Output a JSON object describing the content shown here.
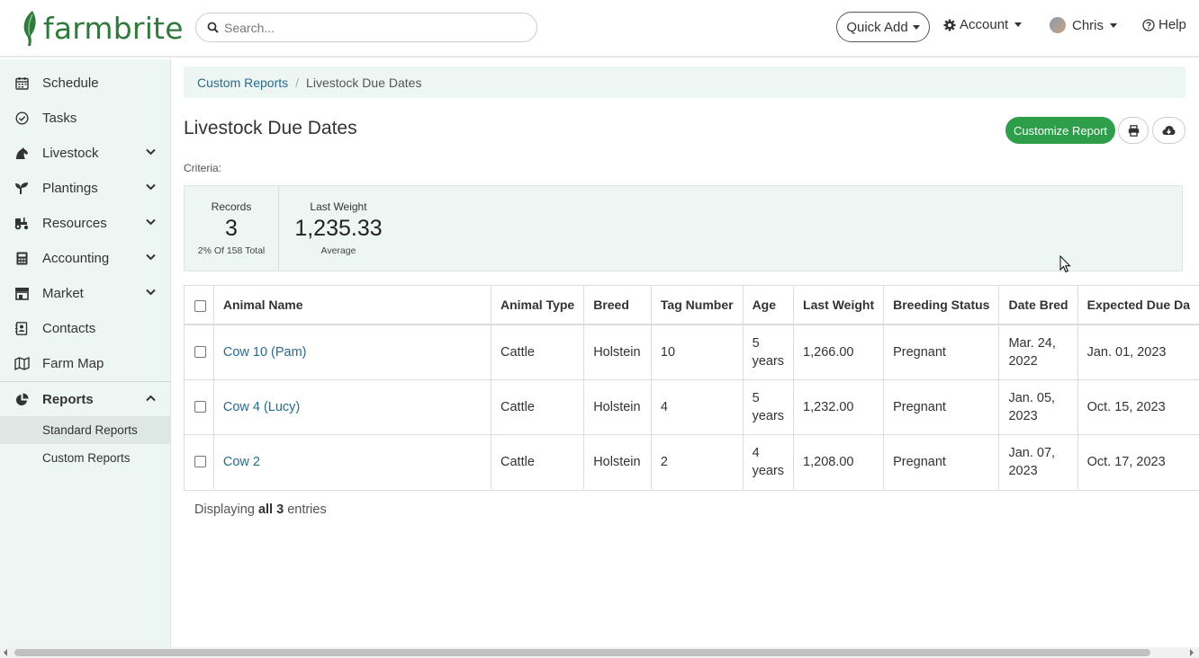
{
  "brand": {
    "name": "farmbrite",
    "color": "#2f7a3c"
  },
  "search": {
    "placeholder": "Search..."
  },
  "topnav": {
    "quick_add": "Quick Add",
    "account": "Account",
    "user": "Chris",
    "help": "Help"
  },
  "sidebar": {
    "items": [
      {
        "label": "Schedule",
        "icon": "calendar-icon"
      },
      {
        "label": "Tasks",
        "icon": "check-circle-icon"
      },
      {
        "label": "Livestock",
        "icon": "horse-icon"
      },
      {
        "label": "Plantings",
        "icon": "seedling-icon"
      },
      {
        "label": "Resources",
        "icon": "tractor-icon"
      },
      {
        "label": "Accounting",
        "icon": "calculator-icon"
      },
      {
        "label": "Market",
        "icon": "store-icon"
      },
      {
        "label": "Contacts",
        "icon": "address-book-icon"
      },
      {
        "label": "Farm Map",
        "icon": "map-icon"
      },
      {
        "label": "Reports",
        "icon": "pie-chart-icon"
      }
    ],
    "reports_sub": [
      "Standard Reports",
      "Custom Reports"
    ]
  },
  "breadcrumb": {
    "parent": "Custom Reports",
    "current": "Livestock Due Dates"
  },
  "page": {
    "title": "Livestock Due Dates",
    "customize": "Customize Report",
    "criteria": "Criteria:"
  },
  "stats": {
    "records": {
      "label": "Records",
      "value": "3",
      "sub": "2% Of 158 Total"
    },
    "weight": {
      "label": "Last Weight",
      "value": "1,235.33",
      "sub": "Average"
    }
  },
  "table": {
    "headers": [
      "Animal Name",
      "Animal Type",
      "Breed",
      "Tag Number",
      "Age",
      "Last Weight",
      "Breeding Status",
      "Date Bred",
      "Expected Due Da"
    ],
    "rows": [
      [
        "Cow 10 (Pam)",
        "Cattle",
        "Holstein",
        "10",
        "5 years",
        "1,266.00",
        "Pregnant",
        "Mar. 24, 2022",
        "Jan. 01, 2023"
      ],
      [
        "Cow 4 (Lucy)",
        "Cattle",
        "Holstein",
        "4",
        "5 years",
        "1,232.00",
        "Pregnant",
        "Jan. 05, 2023",
        "Oct. 15, 2023"
      ],
      [
        "Cow 2",
        "Cattle",
        "Holstein",
        "2",
        "4 years",
        "1,208.00",
        "Pregnant",
        "Jan. 07, 2023",
        "Oct. 17, 2023"
      ]
    ]
  },
  "footer": {
    "prefix": "Displaying",
    "strong": "all 3",
    "suffix": "entries"
  },
  "colors": {
    "accent_green": "#2e9e4b",
    "link": "#2a6a8d",
    "sidebar_bg": "#eef6f4"
  }
}
